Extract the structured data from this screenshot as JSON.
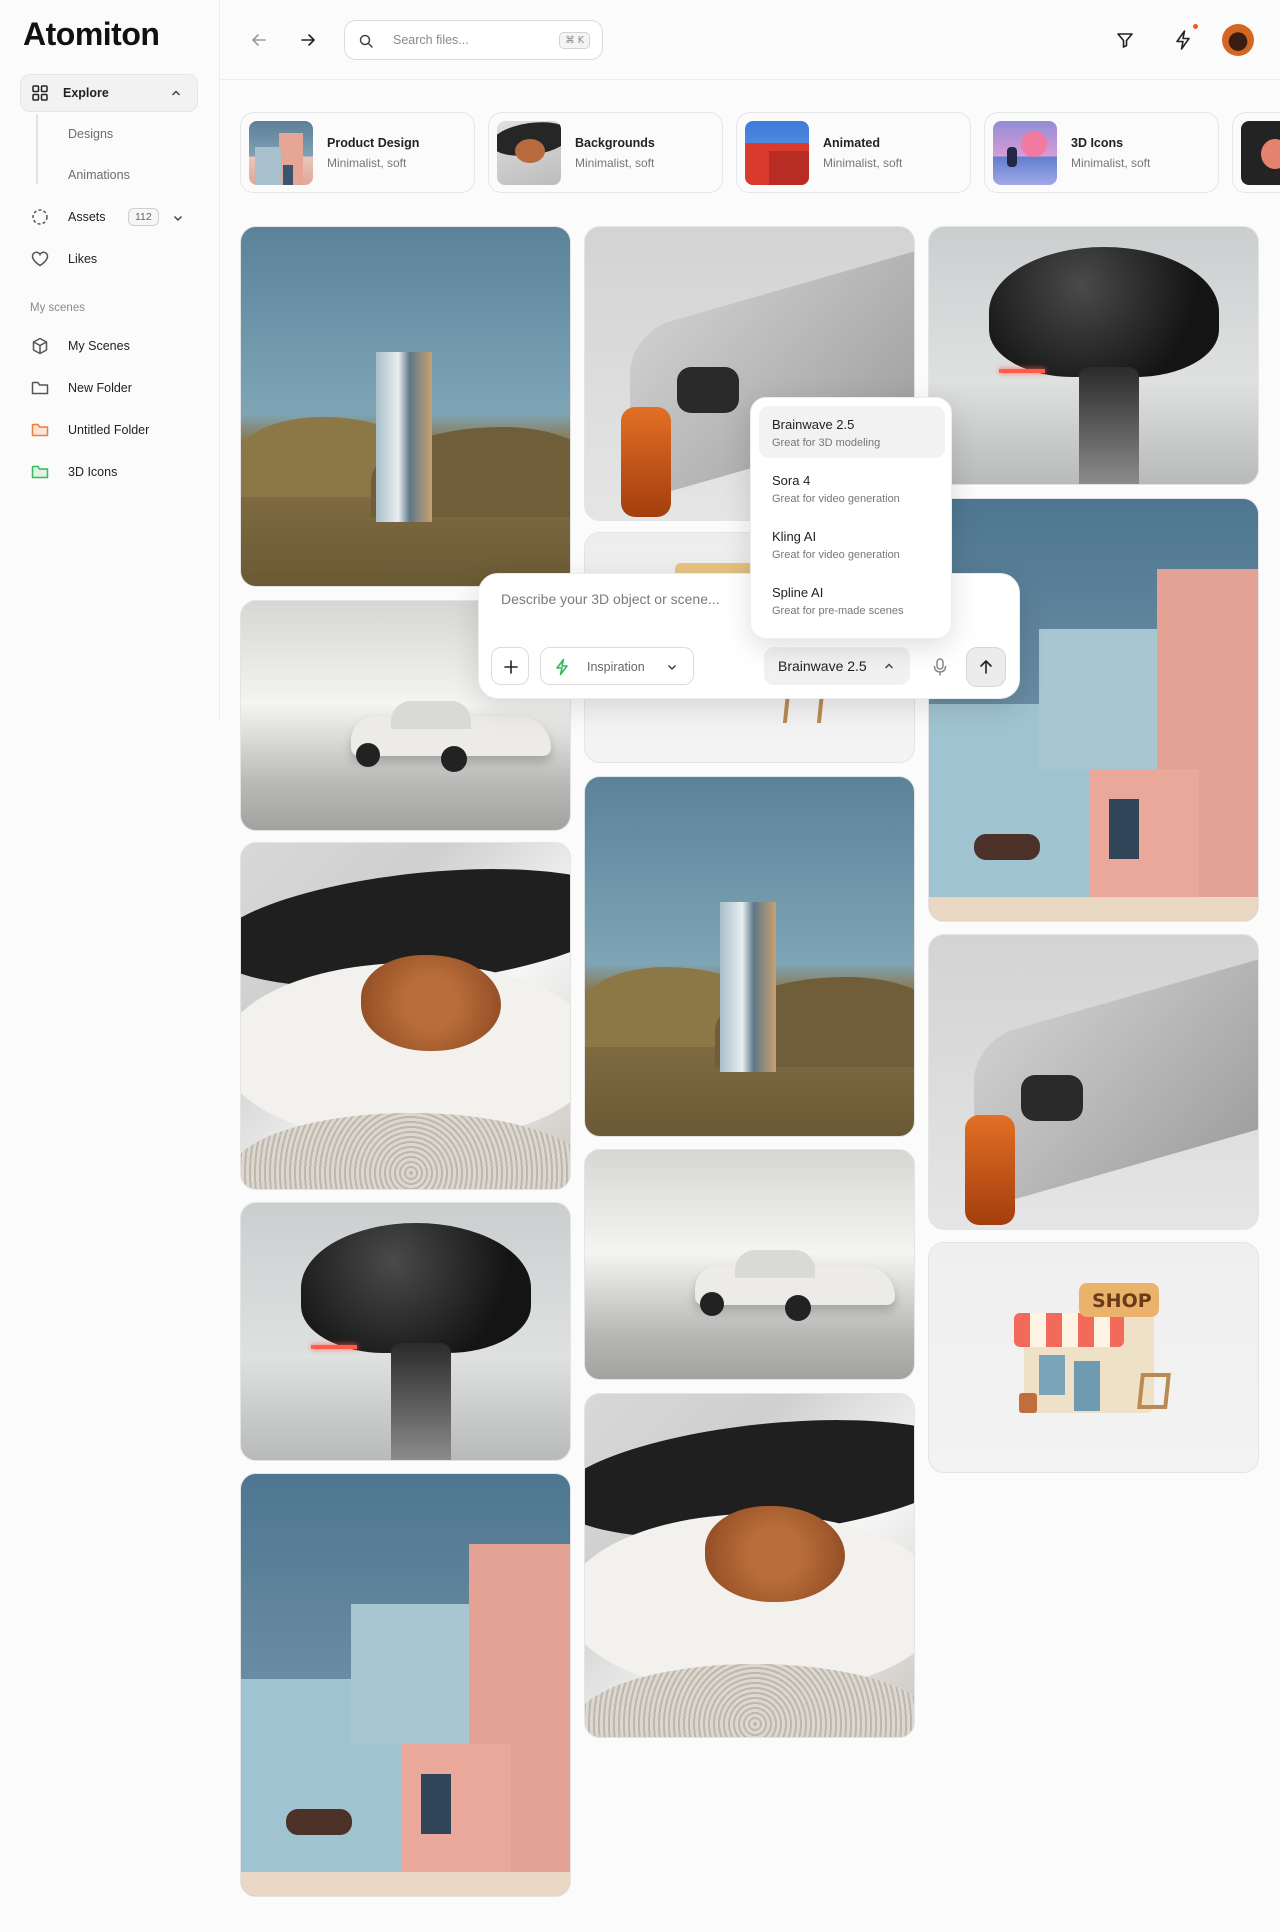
{
  "app": {
    "title": "Atomiton"
  },
  "sidebar": {
    "explore_label": "Explore",
    "sub_items": [
      "Designs",
      "Animations"
    ],
    "assets_label": "Assets",
    "assets_count": "112",
    "likes_label": "Likes",
    "section_label": "My scenes",
    "scenes": [
      {
        "label": "My Scenes",
        "icon": "cube-icon"
      },
      {
        "label": "New Folder",
        "icon": "folder-icon"
      },
      {
        "label": "Untitled Folder",
        "icon": "folder-icon",
        "color": "#f07a3a"
      },
      {
        "label": "3D Icons",
        "icon": "folder-icon",
        "color": "#37b65a"
      }
    ]
  },
  "topbar": {
    "search_placeholder": "Search files...",
    "search_shortcut": "⌘ K"
  },
  "categories": [
    {
      "title": "Product Design",
      "subtitle": "Minimalist, soft"
    },
    {
      "title": "Backgrounds",
      "subtitle": "Minimalist, soft"
    },
    {
      "title": "Animated",
      "subtitle": "Minimalist, soft"
    },
    {
      "title": "3D Icons",
      "subtitle": "Minimalist, soft"
    }
  ],
  "prompt": {
    "placeholder": "Describe your 3D object or scene...",
    "inspiration_label": "Inspiration",
    "model_label": "Brainwave 2.5"
  },
  "model_menu": [
    {
      "name": "Brainwave 2.5",
      "desc": "Great for 3D modeling",
      "selected": true
    },
    {
      "name": "Sora 4",
      "desc": "Great for video generation",
      "selected": false
    },
    {
      "name": "Kling AI",
      "desc": "Great for video generation",
      "selected": false
    },
    {
      "name": "Spline AI",
      "desc": "Great for pre-made scenes",
      "selected": false
    }
  ],
  "shop_sign": "SHOP",
  "colors": {
    "accent": "#f25a1d",
    "folder_orange": "#f07a3a",
    "folder_green": "#37b65a"
  }
}
